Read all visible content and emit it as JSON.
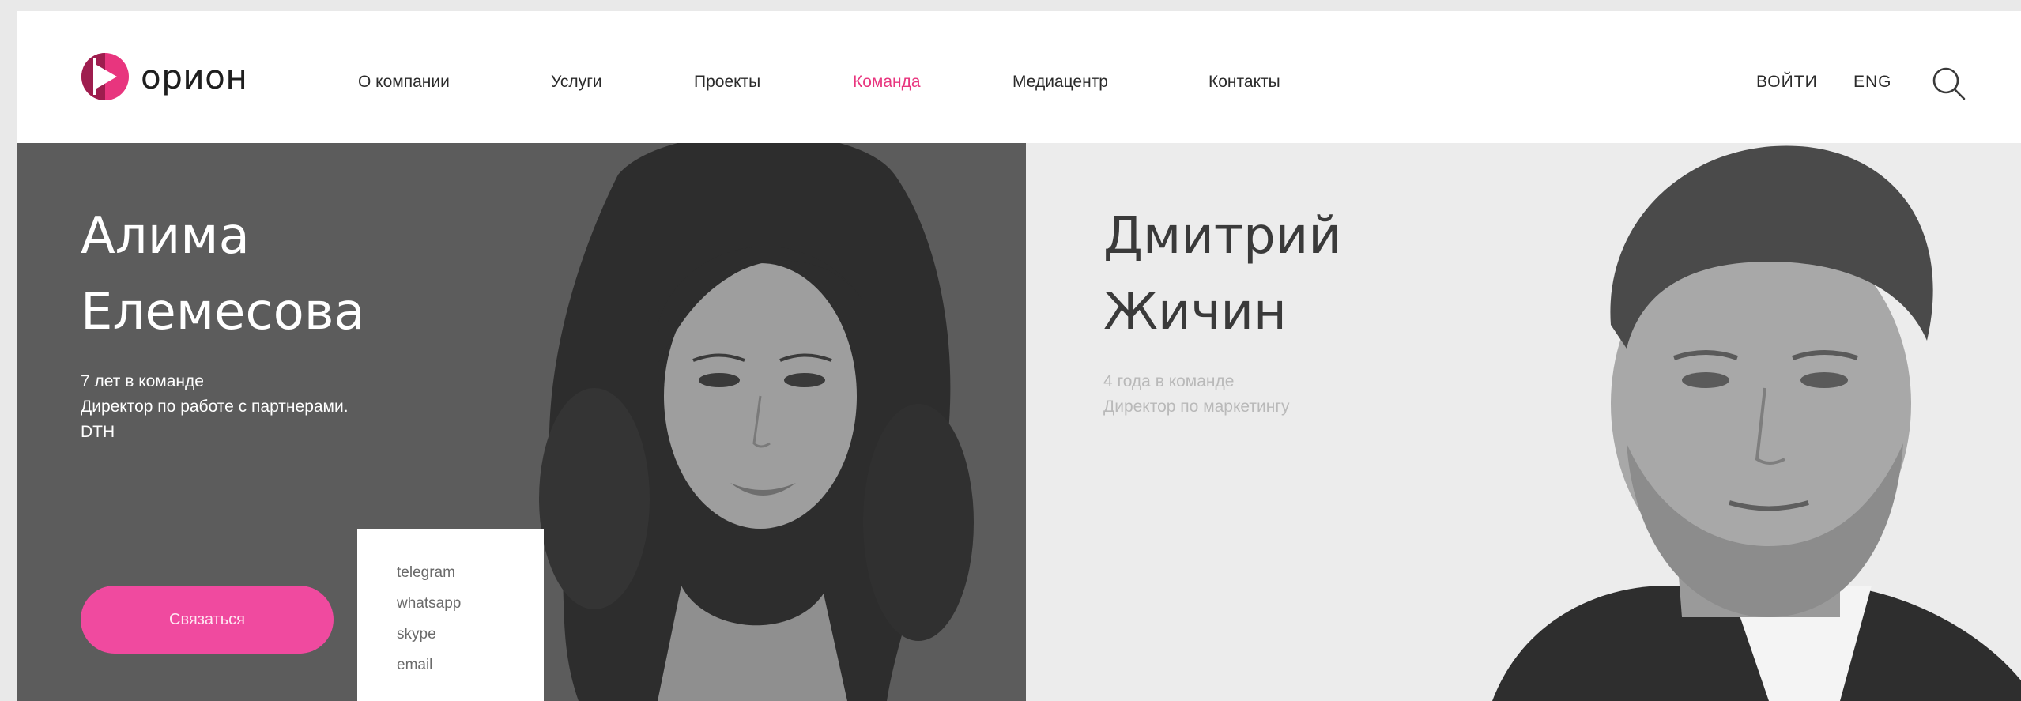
{
  "header": {
    "logo_text": "орион",
    "nav": [
      {
        "label": "О компании",
        "active": false
      },
      {
        "label": "Услуги",
        "active": false
      },
      {
        "label": "Проекты",
        "active": false
      },
      {
        "label": "Команда",
        "active": true
      },
      {
        "label": "Медиацентр",
        "active": false
      },
      {
        "label": "Контакты",
        "active": false
      }
    ],
    "login_label": "ВОЙТИ",
    "lang_label": "ENG",
    "search_icon": "search-icon"
  },
  "team": [
    {
      "name_line1": "Алима",
      "name_line2": "Елемесова",
      "tenure": "7 лет в команде",
      "role_line1": "Директор по работе с партнерами.",
      "role_line2": "DTH",
      "contact_button": "Связаться",
      "contact_options": [
        "telegram",
        "whatsapp",
        "skype",
        "email"
      ]
    },
    {
      "name_line1": "Дмитрий",
      "name_line2": "Жичин",
      "tenure": "4 года в команде",
      "role_line1": "Директор по маркетингу"
    }
  ],
  "colors": {
    "accent": "#e8357e",
    "button": "#f04a9f",
    "left_panel": "#5c5c5c",
    "right_panel": "#ececec"
  }
}
